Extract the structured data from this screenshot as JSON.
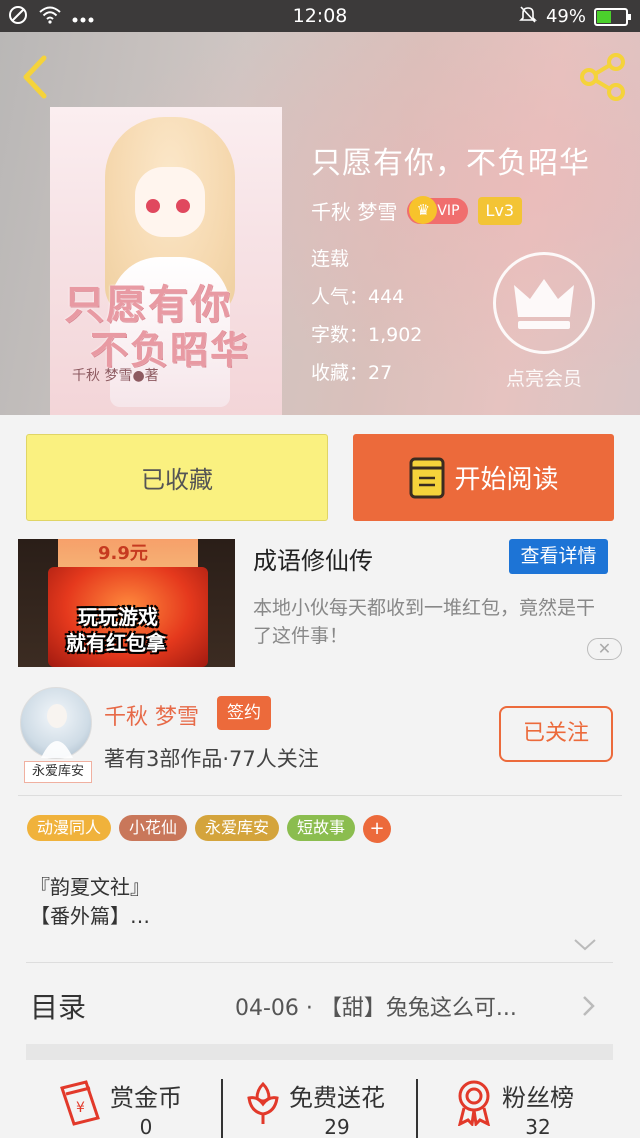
{
  "status_bar": {
    "time": "12:08",
    "battery": "49%",
    "battery_level": 0.49
  },
  "book": {
    "title": "只愿有你，不负昭华",
    "author": "千秋 梦雪",
    "vip": "VIP",
    "level": "Lv3",
    "status": "连载",
    "popularity": "人气：444",
    "word_count": "字数：1,902",
    "favorites": "收藏：27",
    "vip_cta": "点亮会员",
    "cover": {
      "title_line1": "只愿有你",
      "title_line2": "不负昭华",
      "author": "千秋 梦雪●著"
    }
  },
  "actions": {
    "favorited": "已收藏",
    "start_reading": "开始阅读"
  },
  "ad": {
    "image_price": "9.9元",
    "image_line1": "玩玩游戏",
    "image_line2": "就有红包拿",
    "title": "成语修仙传",
    "detail_button": "查看详情",
    "description": "本地小伙每天都收到一堆红包，竟然是干了这件事！",
    "close": "✕"
  },
  "author_card": {
    "name": "千秋 梦雪",
    "sign_badge": "签约",
    "avatar_tag": "永爱库安",
    "info": "著有3部作品·77人关注",
    "follow_button": "已关注"
  },
  "tags": [
    {
      "label": "动漫同人",
      "color": "#f0b23b"
    },
    {
      "label": "小花仙",
      "color": "#c9775a"
    },
    {
      "label": "永爱库安",
      "color": "#d4a43c"
    },
    {
      "label": "短故事",
      "color": "#8bbd4f"
    }
  ],
  "tag_more": "+",
  "description": {
    "line1": "『韵夏文社』",
    "line2": "【番外篇】…"
  },
  "toc": {
    "label": "目录",
    "latest": "04-06 · 【甜】兔兔这么可..."
  },
  "bottom": {
    "reward": {
      "label": "赏金币",
      "count": "0"
    },
    "flowers": {
      "label": "免费送花",
      "count": "29"
    },
    "fans": {
      "label": "粉丝榜",
      "count": "32"
    }
  },
  "colors": {
    "accent": "#ec6a3b",
    "fav_yellow": "#faf180",
    "ad_blue": "#1d74d6"
  }
}
